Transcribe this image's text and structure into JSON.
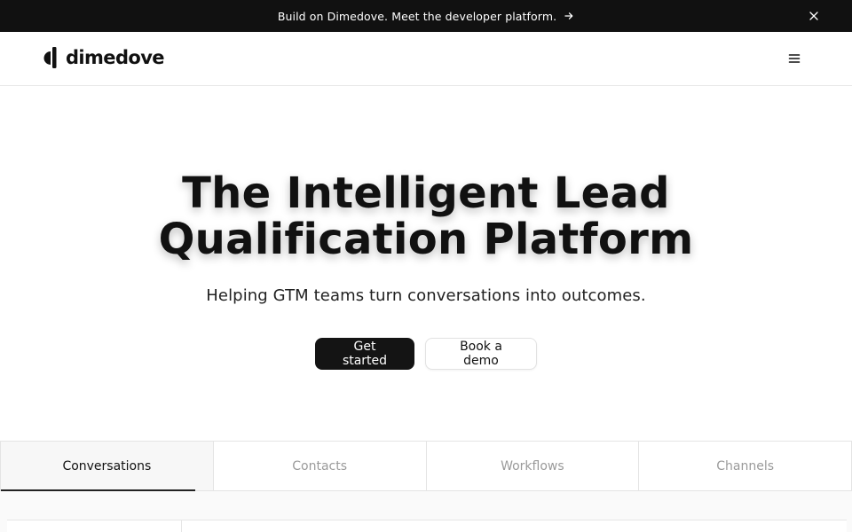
{
  "announcement": {
    "text": "Build on Dimedove. Meet the developer platform.",
    "arrow_icon": "arrow-right-icon",
    "close_icon": "close-icon"
  },
  "nav": {
    "brand": "dimedove",
    "menu_icon": "hamburger-menu-icon"
  },
  "hero": {
    "title_line1": "The Intelligent Lead",
    "title_line2": "Qualification Platform",
    "subtitle": "Helping GTM teams turn conversations into outcomes.",
    "primary_cta": "Get started",
    "secondary_cta": "Book a demo"
  },
  "tabs": [
    {
      "label": "Conversations",
      "active": true
    },
    {
      "label": "Contacts",
      "active": false
    },
    {
      "label": "Workflows",
      "active": false
    },
    {
      "label": "Channels",
      "active": false
    }
  ],
  "colors": {
    "banner_bg": "#111111",
    "primary_button_bg": "#141414",
    "border": "#e4e4e4"
  }
}
